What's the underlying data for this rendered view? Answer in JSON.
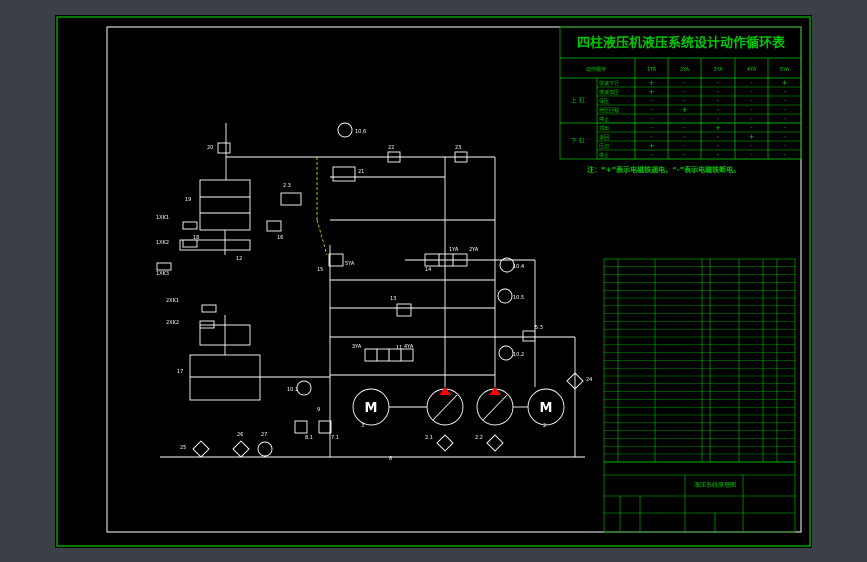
{
  "title": "四柱液压机液压系统设计动作循环表",
  "table_header": {
    "action_col": "动作顺序",
    "valves": [
      "1YA",
      "2YA",
      "3YA",
      "4YA",
      "5YA"
    ]
  },
  "groups": [
    {
      "label": "上 缸",
      "rows": [
        {
          "name": "快速下行",
          "states": [
            "+",
            "-",
            "-",
            "-",
            "+"
          ]
        },
        {
          "name": "慢速加压",
          "states": [
            "+",
            "-",
            "-",
            "-",
            "-"
          ]
        },
        {
          "name": "保压",
          "states": [
            "-",
            "-",
            "-",
            "-",
            "-"
          ]
        },
        {
          "name": "泄压回程",
          "states": [
            "-",
            "+",
            "-",
            "-",
            "-"
          ]
        },
        {
          "name": "停止",
          "states": [
            "-",
            "-",
            "-",
            "-",
            "-"
          ]
        }
      ]
    },
    {
      "label": "下 缸",
      "rows": [
        {
          "name": "顶出",
          "states": [
            "-",
            "-",
            "+",
            "-",
            "-"
          ]
        },
        {
          "name": "退回",
          "states": [
            "-",
            "-",
            "-",
            "+",
            "-"
          ]
        },
        {
          "name": "压边",
          "states": [
            "+",
            "-",
            "-",
            "-",
            "-"
          ]
        },
        {
          "name": "停止",
          "states": [
            "-",
            "-",
            "-",
            "-",
            "-"
          ]
        }
      ]
    }
  ],
  "note": "注：“+”表示电磁铁通电，“-”表示电磁铁断电。",
  "labels": {
    "gauge_top": "10.6",
    "dev_22": "22",
    "dev_23": "23",
    "dev_20": "20",
    "dev_21": "21",
    "dev_19": "19",
    "dev_18": "18",
    "dev_16": "16",
    "dev_15": "15",
    "dev_14": "14",
    "dev_13": "13",
    "dev_11": "11",
    "dev_17": "17",
    "dev_9": "9",
    "dev_8": "8",
    "dev_3": "3",
    "dev_2": "2",
    "dev_1": "1",
    "dev_25": "25",
    "dev_26": "26",
    "dev_27": "27",
    "dev_24": "24",
    "dev_12": "12",
    "relief_top": "2.3",
    "relief_left": "8.1",
    "relief_left2": "7.1",
    "relief_right": "5.3",
    "gauge_right1": "10.4",
    "gauge_right2": "10.5",
    "gauge_right3": "10.2",
    "gauge_left": "10.1",
    "pump_left": "2.1",
    "pump_right": "2.2",
    "sol_1ya": "1YA",
    "sol_2ya": "2YA",
    "sol_3ya": "3YA",
    "sol_4ya": "4YA",
    "sol_5ya": "5YA",
    "sw_1": "1XK1",
    "sw_2": "1XK2",
    "sw_3": "1XK3",
    "sw_4": "2XK1",
    "sw_5": "2XK2",
    "motor": "M"
  },
  "title_block": {
    "drawing_name": "液压系统原理图"
  }
}
